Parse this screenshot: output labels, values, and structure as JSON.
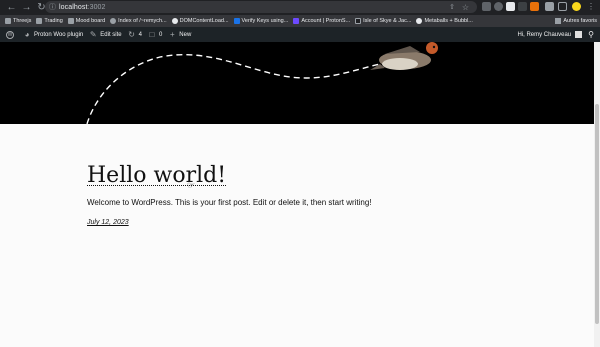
{
  "browser": {
    "url_host": "localhost",
    "url_port": ":3002"
  },
  "bookmarks": [
    {
      "label": "Threejs",
      "icon": "folder-icon"
    },
    {
      "label": "Trading",
      "icon": "folder-icon"
    },
    {
      "label": "Mood board",
      "icon": "folder-icon"
    },
    {
      "label": "Index of /~remych...",
      "icon": "globe-icon"
    },
    {
      "label": "DOMContentLoad...",
      "icon": "github-icon"
    },
    {
      "label": "Verify Keys using...",
      "icon": "blue-app-icon"
    },
    {
      "label": "Account | ProtonS...",
      "icon": "proton-icon"
    },
    {
      "label": "Isle of Skye & Jac...",
      "icon": "skye-icon"
    },
    {
      "label": "Metaballs + Bubbl...",
      "icon": "codepen-icon"
    }
  ],
  "bookmarks_other": "Autres favoris",
  "adminbar": {
    "site_name": "Proton Woo plugin",
    "edit_site": "Edit site",
    "updates_count": "4",
    "comments_count": "0",
    "new_label": "New",
    "greeting": "Hi, Remy Chauveau"
  },
  "post": {
    "title": "Hello world!",
    "excerpt": "Welcome to WordPress. This is your first post. Edit or delete it, then start writing!",
    "date": "July 12, 2023"
  }
}
